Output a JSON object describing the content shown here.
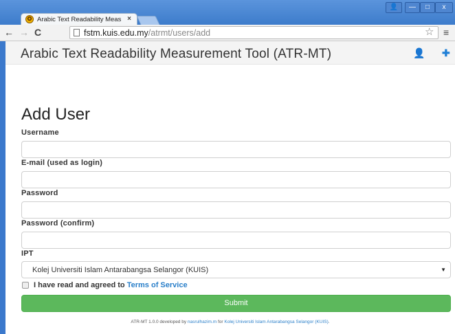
{
  "browser": {
    "tab_title": "Arabic Text Readability Meas",
    "tab_close": "×",
    "url_host": "fstm.kuis.edu.my",
    "url_path": "/atrmt/users/add",
    "win_user": "👤",
    "win_min": "—",
    "win_max": "□",
    "win_close": "x",
    "back": "←",
    "forward": "→",
    "reload": "C",
    "star": "☆",
    "menu": "≡"
  },
  "navbar": {
    "brand": "Arabic Text Readability Measurement Tool (ATR-MT)",
    "user_icon": "👤",
    "plus_icon": "✚"
  },
  "form": {
    "heading": "Add User",
    "username_label": "Username",
    "email_label": "E-mail (used as login)",
    "password_label": "Password",
    "password_confirm_label": "Password (confirm)",
    "ipt_label": "IPT",
    "ipt_selected": "Kolej Universiti Islam Antarabangsa Selangor (KUIS)",
    "agree_text": "I have read and agreed to ",
    "terms_link": "Terms of Service",
    "submit_label": "Submit"
  },
  "footer": {
    "prefix": "ATR-MT 1.0.0 developed by ",
    "author": "nasrulhazim.m",
    "middle": " for ",
    "org": "Kolej Universiti Islam Antarabangsa Selangor (KUIS)",
    "suffix": "."
  },
  "colors": {
    "accent": "#2a7fc9",
    "submit": "#5cb85c"
  }
}
